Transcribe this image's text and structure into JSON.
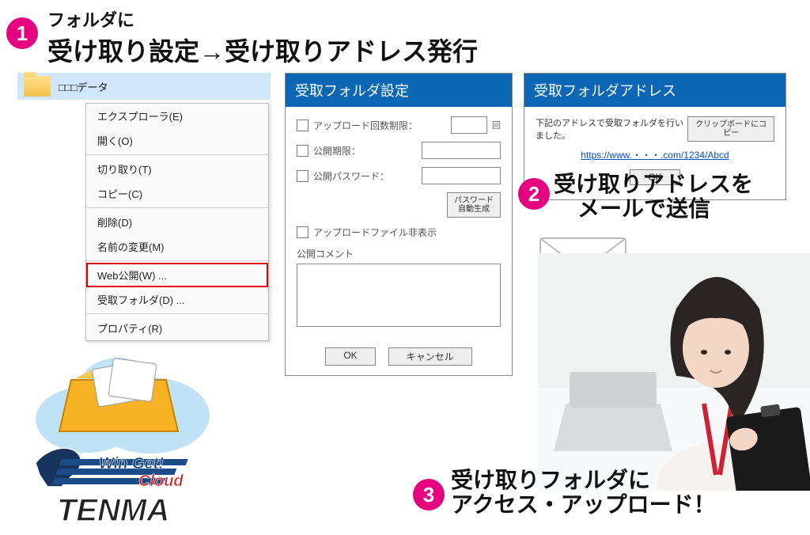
{
  "step1": {
    "sub": "フォルダに",
    "main": "受け取り設定→受け取りアドレス発行"
  },
  "step2": {
    "line1": "受け取りアドレスを",
    "line2": "メールで送信"
  },
  "step3": {
    "line1": "受け取りフォルダに",
    "line2": "アクセス・アップロード！"
  },
  "folder": {
    "name": "□□□データ"
  },
  "context_menu": {
    "explorer": "エクスプローラ(E)",
    "open": "開く(O)",
    "cut": "切り取り(T)",
    "copy": "コピー(C)",
    "delete": "削除(D)",
    "rename": "名前の変更(M)",
    "web_publish": "Web公開(W) ...",
    "recv_folder": "受取フォルダ(D) ...",
    "properties": "プロパティ(R)"
  },
  "settings": {
    "title": "受取フォルダ設定",
    "upload_limit_label": "アップロード回数制限：",
    "upload_limit_suffix": "回",
    "expiry_label": "公開期限：",
    "password_label": "公開パスワード：",
    "password_gen_btn": "パスワード\n自動生成",
    "hide_file_label": "アップロードファイル非表示",
    "comment_label": "公開コメント",
    "ok": "OK",
    "cancel": "キャンセル"
  },
  "address": {
    "title": "受取フォルダアドレス",
    "msg": "下記のアドレスで受取フォルダを行いました。",
    "copy_btn": "クリップボードにコピー",
    "url": "https://www.・・・.com/1234/Abcd",
    "ok": "OK"
  },
  "logo": {
    "wingget": "Win Get!",
    "cloud": "Cloud",
    "tenma": "TENMA"
  }
}
